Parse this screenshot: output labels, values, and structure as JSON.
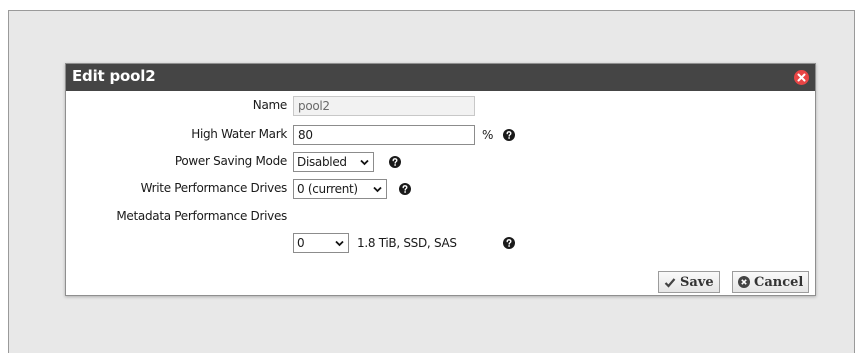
{
  "dialog": {
    "title": "Edit pool2",
    "close_icon": "close-circle-icon",
    "fields": {
      "name": {
        "label": "Name",
        "value": "pool2"
      },
      "high_water_mark": {
        "label": "High Water Mark",
        "value": "80",
        "unit": "%"
      },
      "power_saving_mode": {
        "label": "Power Saving Mode",
        "value": "Disabled"
      },
      "write_performance_drives": {
        "label": "Write Performance Drives",
        "value": "0 (current)"
      },
      "metadata_performance_drives": {
        "label": "Metadata Performance Drives",
        "value": "0",
        "description": "1.8 TiB, SSD, SAS"
      }
    },
    "buttons": {
      "save": "Save",
      "cancel": "Cancel"
    }
  },
  "colors": {
    "titlebar": "#454545",
    "close": "#e84545",
    "background": "#e8e8e8"
  }
}
